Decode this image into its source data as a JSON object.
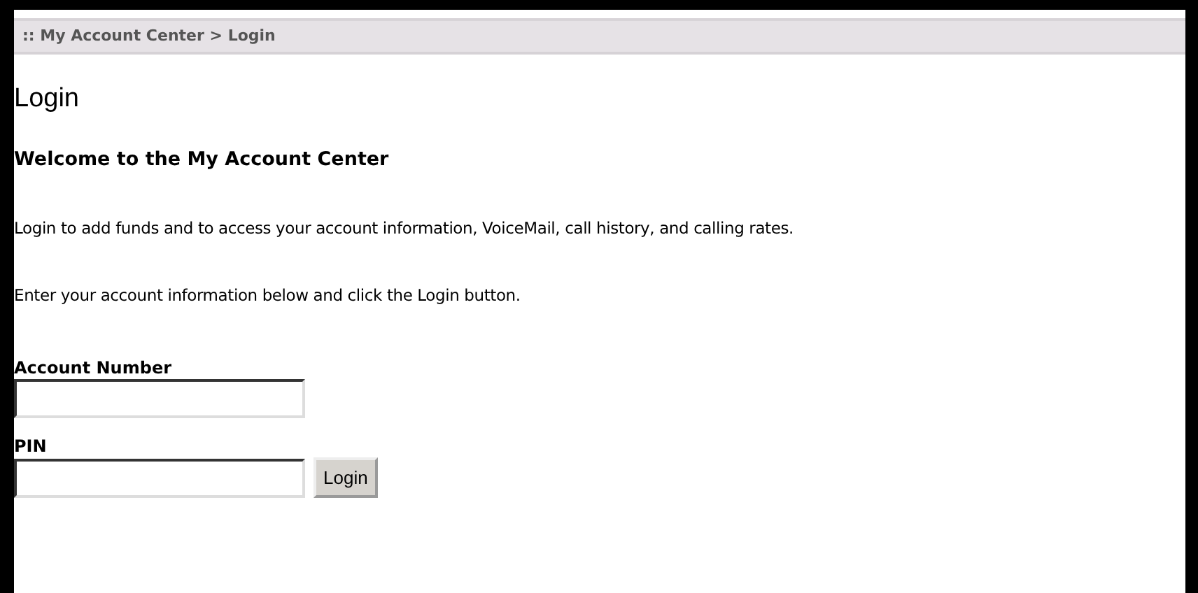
{
  "breadcrumb": ":: My Account Center > Login",
  "title": "Login",
  "welcome": "Welcome to the My Account Center",
  "paragraphs": [
    "Login to add funds and to access your account information, VoiceMail, call history, and calling rates.",
    "Enter your account information below and click the Login button."
  ],
  "fields": [
    {
      "label": "Account Number"
    },
    {
      "label": "PIN",
      "button": "Login"
    }
  ]
}
